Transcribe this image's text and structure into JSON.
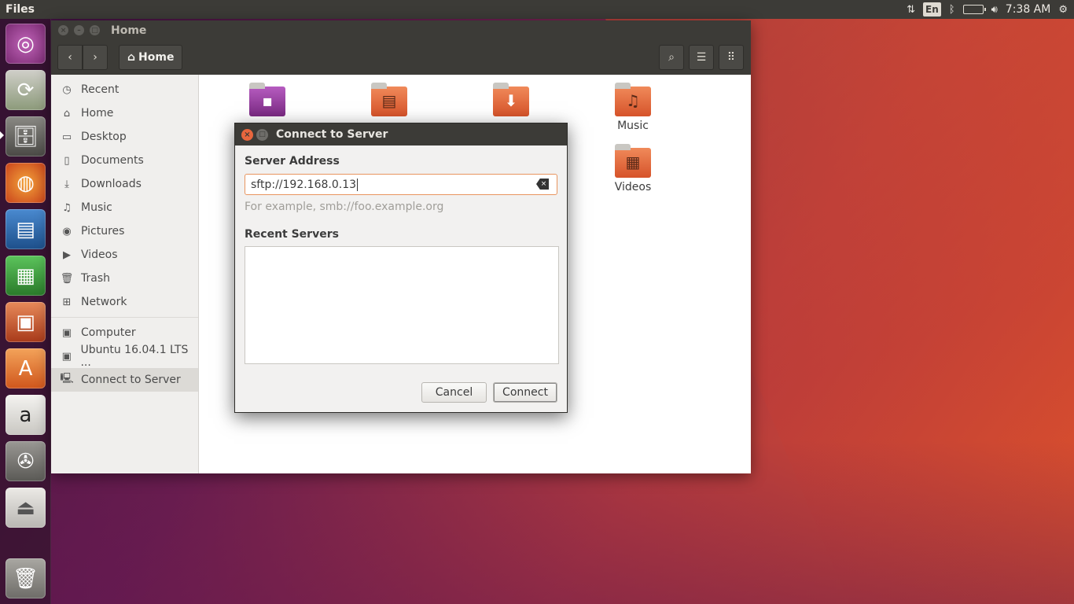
{
  "top_panel": {
    "app_name": "Files",
    "keyboard_layout": "En",
    "time": "7:38 AM"
  },
  "launcher": {
    "items": [
      {
        "name": "Ubuntu Dash",
        "icon": "ubuntu-logo-icon",
        "color": "#8e3f8f"
      },
      {
        "name": "Software Updater",
        "icon": "updater-icon",
        "color": "#7a8a6a"
      },
      {
        "name": "Files",
        "icon": "files-cabinet-icon",
        "color": "#6b6a66",
        "active": true
      },
      {
        "name": "Firefox",
        "icon": "firefox-icon",
        "color": "#e3681d"
      },
      {
        "name": "LibreOffice Writer",
        "icon": "writer-icon",
        "color": "#2a6cb3"
      },
      {
        "name": "LibreOffice Calc",
        "icon": "calc-icon",
        "color": "#3a9a3a"
      },
      {
        "name": "LibreOffice Impress",
        "icon": "impress-icon",
        "color": "#c4562a"
      },
      {
        "name": "Ubuntu Software",
        "icon": "software-center-icon",
        "color": "#e07a2c"
      },
      {
        "name": "Amazon",
        "icon": "amazon-icon",
        "color": "#d0cdc8"
      },
      {
        "name": "System Settings",
        "icon": "settings-icon",
        "color": "#7a7874"
      },
      {
        "name": "USB Drive",
        "icon": "usb-drive-icon",
        "color": "#c5c3be"
      },
      {
        "name": "Trash",
        "icon": "trash-icon",
        "color": "#8a8884"
      }
    ]
  },
  "window": {
    "title": "Home",
    "path_label": "Home"
  },
  "sidebar": {
    "places": [
      {
        "label": "Recent",
        "icon": "clock-icon"
      },
      {
        "label": "Home",
        "icon": "home-icon"
      },
      {
        "label": "Desktop",
        "icon": "folder-icon"
      },
      {
        "label": "Documents",
        "icon": "document-icon"
      },
      {
        "label": "Downloads",
        "icon": "download-icon"
      },
      {
        "label": "Music",
        "icon": "music-icon"
      },
      {
        "label": "Pictures",
        "icon": "camera-icon"
      },
      {
        "label": "Videos",
        "icon": "video-icon"
      },
      {
        "label": "Trash",
        "icon": "trash-icon"
      },
      {
        "label": "Network",
        "icon": "network-icon"
      }
    ],
    "devices": [
      {
        "label": "Computer",
        "icon": "drive-icon"
      },
      {
        "label": "Ubuntu 16.04.1 LTS ...",
        "icon": "disc-icon"
      },
      {
        "label": "Connect to Server",
        "icon": "server-icon",
        "active": true
      }
    ]
  },
  "files": [
    {
      "name": "",
      "icon": "examples-icon"
    },
    {
      "name": "",
      "icon": "documents-folder-icon"
    },
    {
      "name": "",
      "icon": "downloads-folder-icon"
    },
    {
      "name": "Music",
      "icon": "music-folder-icon"
    },
    {
      "name": "Videos",
      "icon": "videos-folder-icon"
    }
  ],
  "dialog": {
    "title": "Connect to Server",
    "server_address_label": "Server Address",
    "server_address_value": "sftp://192.168.0.13",
    "hint": "For example, smb://foo.example.org",
    "recent_servers_label": "Recent Servers",
    "cancel_label": "Cancel",
    "connect_label": "Connect"
  }
}
